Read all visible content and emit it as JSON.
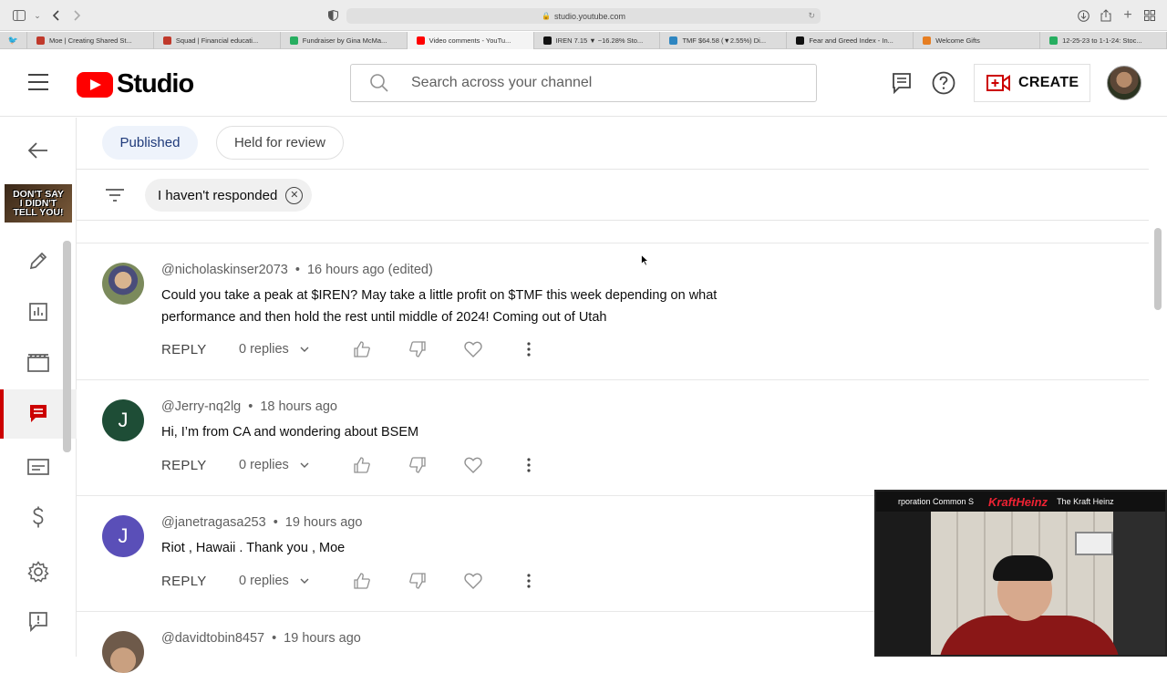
{
  "browser": {
    "url": "studio.youtube.com",
    "tabs": [
      {
        "label": "Moe | Creating Shared St...",
        "color": "#c0392b"
      },
      {
        "label": "Squad | Financial educati...",
        "color": "#c0392b"
      },
      {
        "label": "Fundraiser by Gina McMa...",
        "color": "#27ae60"
      },
      {
        "label": "Video comments - YouTu...",
        "color": "#ff0000",
        "active": true
      },
      {
        "label": "IREN 7.15 ▼ −16.28% Sto...",
        "color": "#111111"
      },
      {
        "label": "TMF $64.58 (▼2.55%) Di...",
        "color": "#2e86c1"
      },
      {
        "label": "Fear and Greed Index - In...",
        "color": "#111111"
      },
      {
        "label": "Welcome Gifts",
        "color": "#e67e22"
      },
      {
        "label": "12-25-23 to 1-1-24: Stoc...",
        "color": "#27ae60"
      }
    ]
  },
  "header": {
    "logo_text": "Studio",
    "search_placeholder": "Search across your channel",
    "create_label": "CREATE"
  },
  "rail": {
    "thumbnail_lines": [
      "DON'T SAY",
      "I DIDN'T",
      "TELL YOU!"
    ]
  },
  "subtabs": {
    "published": "Published",
    "held": "Held for review"
  },
  "filter": {
    "chip_label": "I haven't responded"
  },
  "comments": [
    {
      "author": "@nicholaskinser2073",
      "time": "16 hours ago (edited)",
      "text": "Could you take a peak at $IREN? May take a little profit on $TMF this week depending on what performance and then hold the rest until middle of 2024! Coming out of Utah",
      "reply_label": "REPLY",
      "replies": "0 replies",
      "avatar_letter": "",
      "avatar_color": "#6a7a4a"
    },
    {
      "author": "@Jerry-nq2lg",
      "time": "18 hours ago",
      "text": "Hi, I’m from CA and wondering about BSEM",
      "reply_label": "REPLY",
      "replies": "0 replies",
      "avatar_letter": "J",
      "avatar_color": "#1e4d36"
    },
    {
      "author": "@janetragasa253",
      "time": "19 hours ago",
      "text": "Riot , Hawaii . Thank you , Moe",
      "reply_label": "REPLY",
      "replies": "0 replies",
      "avatar_letter": "J",
      "avatar_color": "#5a4fb8"
    },
    {
      "author": "@davidtobin8457",
      "time": "19 hours ago",
      "text": "",
      "avatar_letter": "",
      "avatar_color": "#7a6a5a"
    }
  ],
  "webcam": {
    "ticker_left": "rporation Common S",
    "ticker_brand": "KraftHeinz",
    "ticker_right": "The Kraft Heinz"
  }
}
